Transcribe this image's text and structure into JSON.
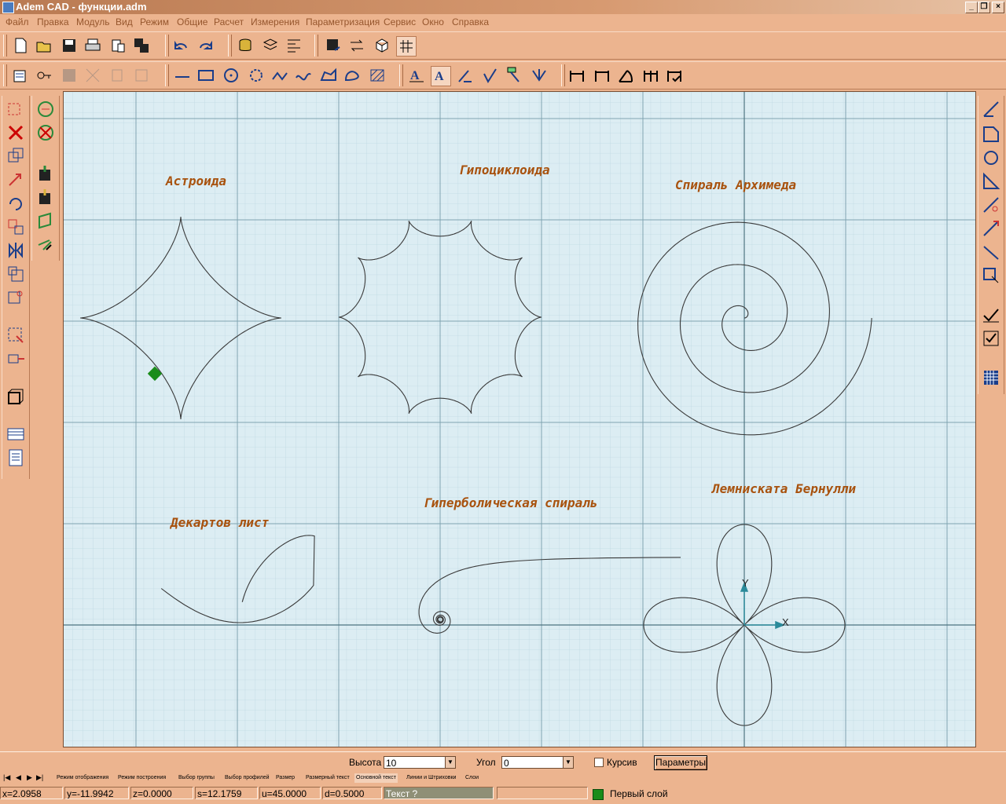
{
  "window": {
    "title": "Adem CAD - функции.adm"
  },
  "menu": [
    "Файл",
    "Правка",
    "Модуль",
    "Вид",
    "Режим",
    "Общие",
    "Расчет",
    "Измерения",
    "Параметризация",
    "Сервис",
    "Окно",
    "Справка"
  ],
  "labels": {
    "astroid": "Астроида",
    "hypocycloid": "Гипоциклоида",
    "archimedes": "Спираль Архимеда",
    "descartes": "Декартов лист",
    "hyperbolic": "Гиперболическая спираль",
    "lemniscate": "Лемниската Бернулли"
  },
  "axes": {
    "x": "X",
    "y": "Y"
  },
  "params": {
    "height_label": "Высота",
    "height_value": "10",
    "angle_label": "Угол",
    "angle_value": "0",
    "italic_label": "Курсив",
    "params_button": "Параметры"
  },
  "tabs": [
    "Режим отображения",
    "Режим построения",
    "Выбор группы",
    "Выбор профилей",
    "Размер",
    "Размерный текст",
    "Основной текст",
    "Линии и Штриховки",
    "Слои"
  ],
  "status": {
    "x": "x=2.0958",
    "y": "y=-11.9942",
    "z": "z=0.0000",
    "s": "s=12.1759",
    "u": "u=45.0000",
    "d": "d=0.5000",
    "prompt": "Текст ?",
    "layer": "Первый слой"
  },
  "colors": {
    "canvas": "#dcedf3",
    "label": "#a8520e",
    "marker": "#1a8c1a"
  }
}
